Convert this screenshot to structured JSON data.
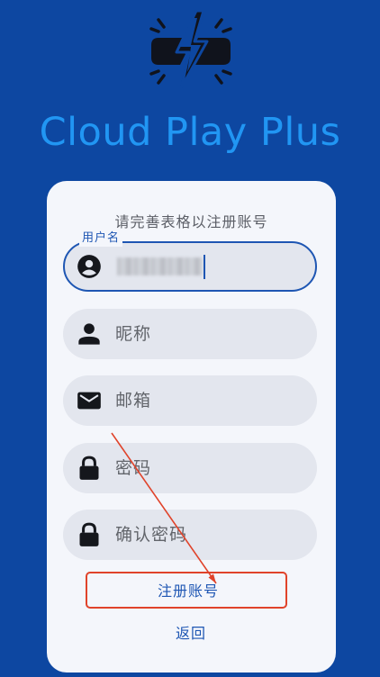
{
  "app": {
    "title": "Cloud Play Plus",
    "logo_icon": "broken-battery-lightning-icon"
  },
  "colors": {
    "background": "#0d47a1",
    "title": "#2196f3",
    "card": "#f4f6fb",
    "field": "#e3e6ee",
    "accent": "#1e56b3",
    "annotation": "#e0432a"
  },
  "form": {
    "subtitle": "请完善表格以注册账号",
    "fields": {
      "username": {
        "label": "用户名",
        "icon": "account-circle-icon",
        "value_visible": "blurred"
      },
      "nickname": {
        "placeholder": "昵称",
        "icon": "person-icon"
      },
      "email": {
        "placeholder": "邮箱",
        "icon": "mail-icon"
      },
      "password": {
        "placeholder": "密码",
        "icon": "lock-icon"
      },
      "confirm_password": {
        "placeholder": "确认密码",
        "icon": "lock-icon"
      }
    },
    "register_label": "注册账号",
    "back_label": "返回"
  },
  "annotation": {
    "type": "red-arrow-and-box",
    "target": "register-button"
  }
}
